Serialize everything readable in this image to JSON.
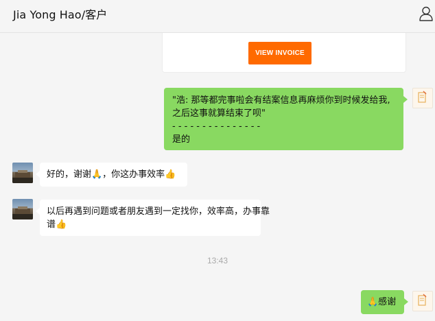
{
  "header": {
    "title": "Jia Yong Hao/客户",
    "profile_icon": "person-outline-icon"
  },
  "invoice": {
    "button_label": "VIEW INVOICE",
    "button_color": "#ff6a00"
  },
  "messages": [
    {
      "direction": "outgoing",
      "lines": [
        "\"浩: 那等都完事啦会有结案信息再麻烦你到时候发给我,",
        "之后这事就算结束了呗\"",
        "- - - - - - - - - - - - - - -",
        "是的"
      ]
    },
    {
      "direction": "incoming",
      "lines": [
        "好的，谢谢🙏，你这办事效率👍"
      ]
    },
    {
      "direction": "incoming",
      "lines": [
        "以后再遇到问题或者朋友遇到一定找你，效率高，办事靠",
        "谱👍"
      ]
    },
    {
      "direction": "outgoing",
      "lines": [
        "🙏感谢"
      ]
    }
  ],
  "timestamp": "13:43",
  "colors": {
    "outgoing_bubble": "#89d961",
    "incoming_bubble": "#ffffff",
    "background": "#f5f5f5"
  }
}
